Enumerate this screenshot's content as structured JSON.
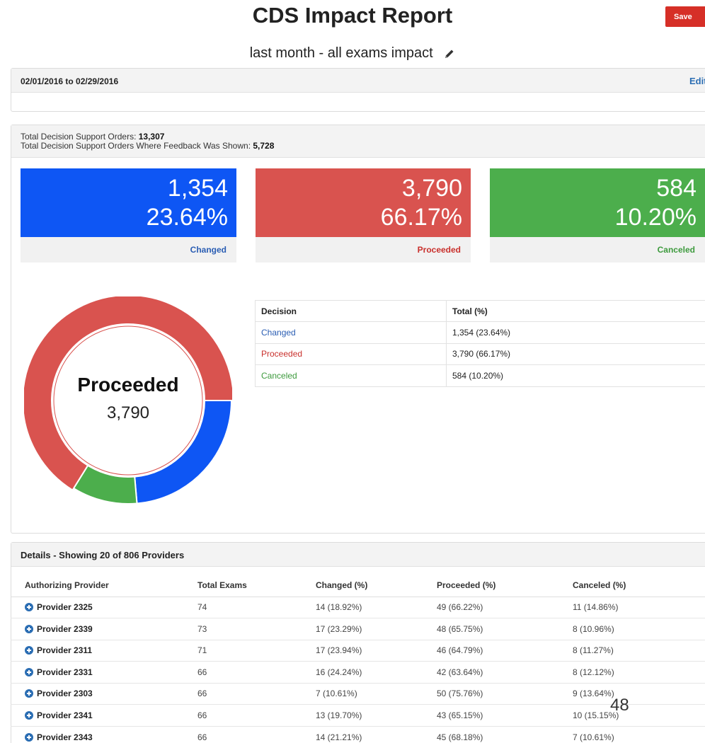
{
  "header": {
    "title": "CDS Impact Report",
    "save_label": "Save",
    "subtitle": "last month - all exams impact"
  },
  "date_panel": {
    "range": "02/01/2016 to 02/29/2016",
    "edit_label": "Edit"
  },
  "summary": {
    "total_orders_label": "Total Decision Support Orders: ",
    "total_orders_value": "13,307",
    "feedback_label": "Total Decision Support Orders Where Feedback Was Shown: ",
    "feedback_value": "5,728",
    "boxes": [
      {
        "count": "1,354",
        "percent": "23.64%",
        "label": "Changed",
        "color": "#0e56f4"
      },
      {
        "count": "3,790",
        "percent": "66.17%",
        "label": "Proceeded",
        "color": "#d9534f"
      },
      {
        "count": "584",
        "percent": "10.20%",
        "label": "Canceled",
        "color": "#4cae4c"
      }
    ]
  },
  "donut": {
    "center_label": "Proceeded",
    "center_value": "3,790"
  },
  "chart_data": {
    "type": "pie",
    "categories": [
      "Changed",
      "Proceeded",
      "Canceled"
    ],
    "values": [
      1354,
      3790,
      584
    ],
    "colors": [
      "#0e56f4",
      "#d9534f",
      "#4cae4c"
    ],
    "title": "",
    "highlighted": "Proceeded"
  },
  "decision_table": {
    "headers": [
      "Decision",
      "Total (%)"
    ],
    "rows": [
      {
        "decision": "Changed",
        "total": "1,354 (23.64%)"
      },
      {
        "decision": "Proceeded",
        "total": "3,790 (66.17%)"
      },
      {
        "decision": "Canceled",
        "total": "584 (10.20%)"
      }
    ]
  },
  "details": {
    "title": "Details - Showing 20 of 806 Providers",
    "headers": [
      "Authorizing Provider",
      "Total Exams",
      "Changed (%)",
      "Proceeded (%)",
      "Canceled (%)"
    ],
    "rows": [
      {
        "provider": "Provider 2325",
        "total": "74",
        "changed": "14 (18.92%)",
        "proceeded": "49 (66.22%)",
        "canceled": "11 (14.86%)"
      },
      {
        "provider": "Provider 2339",
        "total": "73",
        "changed": "17 (23.29%)",
        "proceeded": "48 (65.75%)",
        "canceled": "8 (10.96%)"
      },
      {
        "provider": "Provider 2311",
        "total": "71",
        "changed": "17 (23.94%)",
        "proceeded": "46 (64.79%)",
        "canceled": "8 (11.27%)"
      },
      {
        "provider": "Provider 2331",
        "total": "66",
        "changed": "16 (24.24%)",
        "proceeded": "42 (63.64%)",
        "canceled": "8 (12.12%)"
      },
      {
        "provider": "Provider 2303",
        "total": "66",
        "changed": "7 (10.61%)",
        "proceeded": "50 (75.76%)",
        "canceled": "9 (13.64%)"
      },
      {
        "provider": "Provider 2341",
        "total": "66",
        "changed": "13 (19.70%)",
        "proceeded": "43 (65.15%)",
        "canceled": "10 (15.15%)"
      },
      {
        "provider": "Provider 2343",
        "total": "66",
        "changed": "14 (21.21%)",
        "proceeded": "45 (68.18%)",
        "canceled": "7 (10.61%)"
      }
    ]
  },
  "page_number": "48"
}
